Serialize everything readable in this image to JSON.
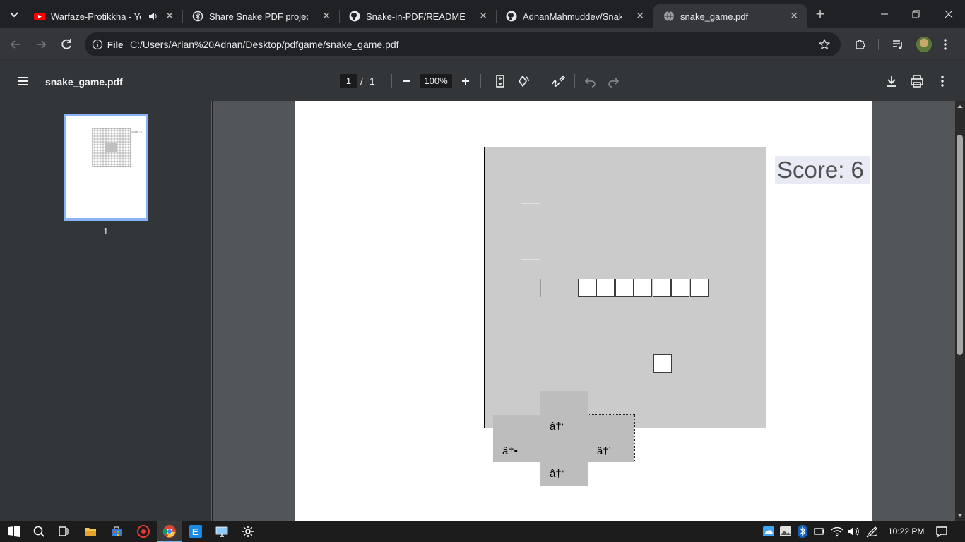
{
  "browser": {
    "tabs": [
      {
        "title": "Warfaze-Protikkha - YouTube",
        "favicon": "youtube-icon",
        "active": false,
        "audio": true
      },
      {
        "title": "Share Snake PDF project",
        "favicon": "chatgpt-icon",
        "active": false
      },
      {
        "title": "Snake-in-PDF/README.md at main",
        "favicon": "github-icon",
        "active": false
      },
      {
        "title": "AdnanMahmuddev/Snake-in-PDF",
        "favicon": "github-icon",
        "active": false
      },
      {
        "title": "snake_game.pdf",
        "favicon": "globe-icon",
        "active": true
      }
    ],
    "address": {
      "scheme_chip": "File",
      "url": "C:/Users/Arian%20Adnan/Desktop/pdfgame/snake_game.pdf"
    }
  },
  "pdf_viewer": {
    "filename": "snake_game.pdf",
    "current_page": "1",
    "page_separator": "/",
    "total_pages": "1",
    "zoom": "100%",
    "thumbnail_label": "1"
  },
  "game": {
    "score_text": "Score: 6",
    "controls": {
      "up": "â†‘",
      "down": "â†“",
      "left": "â†•",
      "right": "â†’"
    }
  },
  "taskbar": {
    "time": "10:22 PM"
  },
  "colors": {
    "accent": "#8ab4f8",
    "board": "#cbcbcb",
    "snake_cell": "#ffffff"
  }
}
